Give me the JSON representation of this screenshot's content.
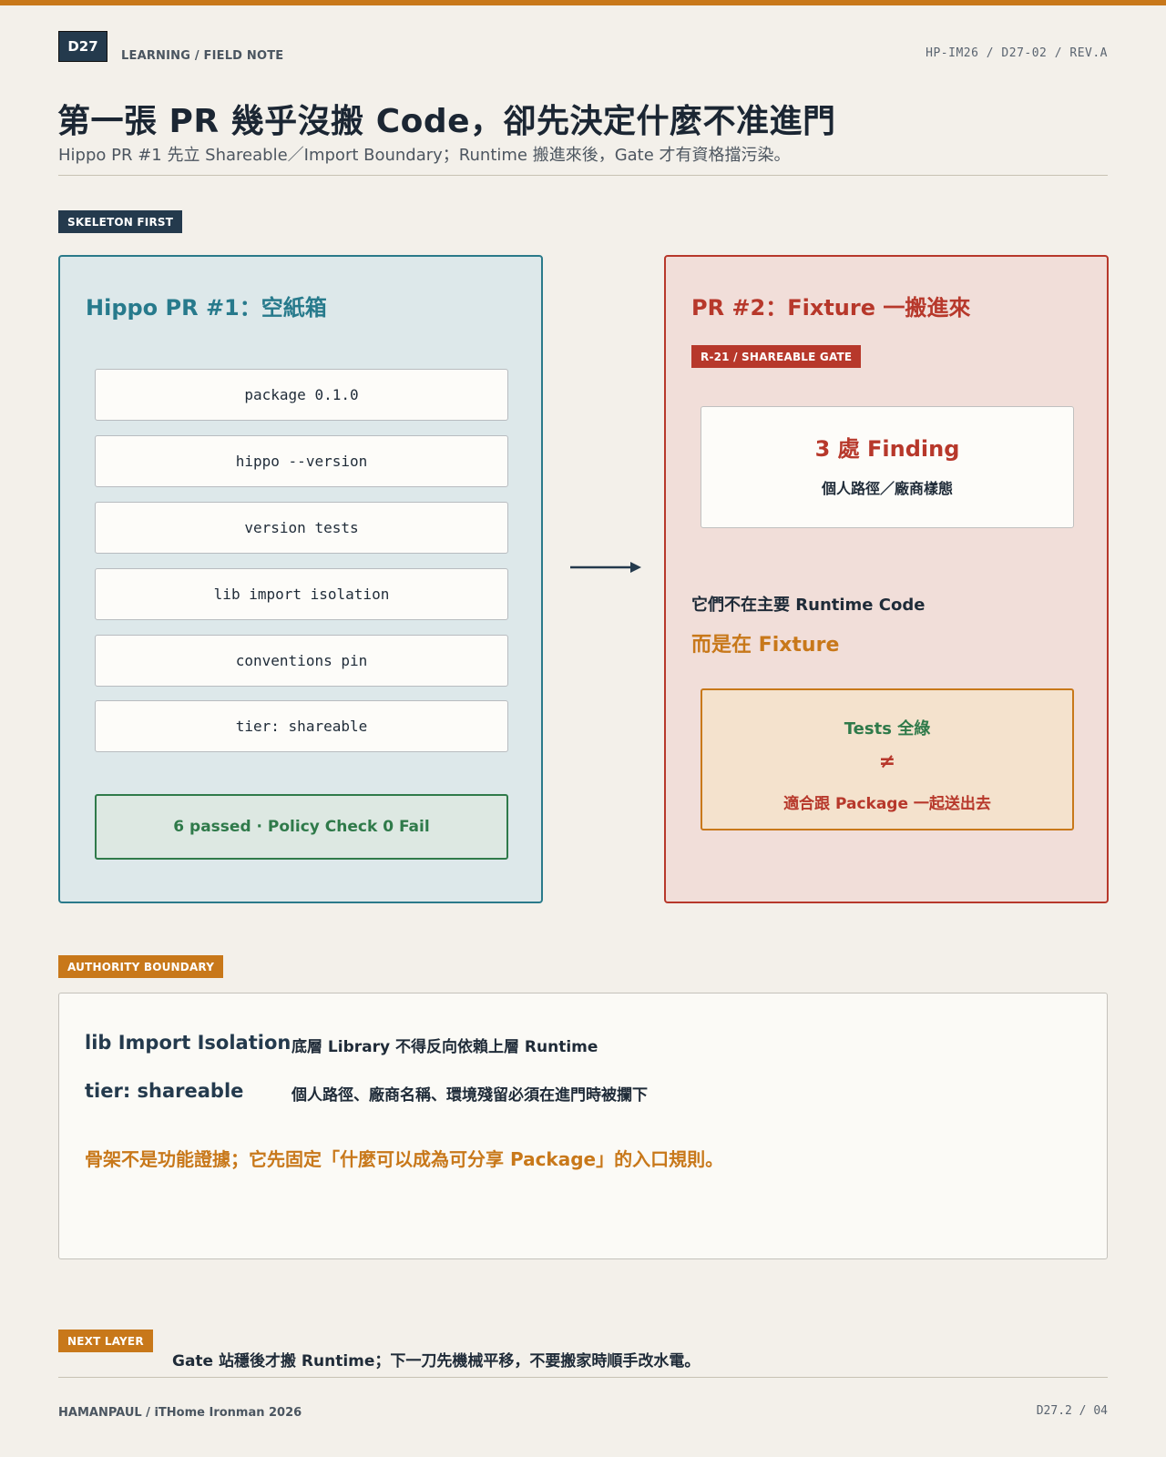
{
  "header": {
    "day_badge": "D27",
    "kicker": "LEARNING / FIELD NOTE",
    "doc_ref": "HP-IM26 / D27-02 / REV.A",
    "title": "第一張 PR 幾乎沒搬 Code，卻先決定什麼不准進門",
    "subtitle": "Hippo PR #1 先立 Shareable／Import Boundary；Runtime 搬進來後，Gate 才有資格擋污染。"
  },
  "skeleton": {
    "tag": "SKELETON FIRST",
    "left_panel": {
      "title": "Hippo PR #1：空紙箱",
      "items": [
        "package 0.1.0",
        "hippo --version",
        "version tests",
        "lib import isolation",
        "conventions pin",
        "tier: shareable"
      ],
      "status": "6 passed · Policy Check 0 Fail"
    },
    "right_panel": {
      "title": "PR #2：Fixture 一搬進來",
      "gate_tag": "R-21 / SHAREABLE GATE",
      "finding_title": "3 處 Finding",
      "finding_detail": "個人路徑／廠商樣態",
      "line1": "它們不在主要 Runtime Code",
      "line2": "而是在 Fixture",
      "tests_green": "Tests 全綠",
      "neq": "≠",
      "tests_note": "適合跟 Package 一起送出去"
    }
  },
  "authority": {
    "tag": "AUTHORITY BOUNDARY",
    "rows": [
      {
        "key": "lib Import Isolation",
        "value": "底層 Library 不得反向依賴上層 Runtime"
      },
      {
        "key": "tier: shareable",
        "value": "個人路徑、廠商名稱、環境殘留必須在進門時被攔下"
      }
    ],
    "note": "骨架不是功能證據；它先固定「什麼可以成為可分享 Package」的入口規則。"
  },
  "next": {
    "tag": "NEXT LAYER",
    "text": "Gate 站穩後才搬 Runtime；下一刀先機械平移，不要搬家時順手改水電。"
  },
  "footer": {
    "left": "HAMANPAUL / iTHome Ironman 2026",
    "right": "D27.2 / 04"
  },
  "colors": {
    "accent_orange": "#c8781a",
    "teal": "#277a8c",
    "red": "#b7382b",
    "green": "#2f7a4a",
    "navy": "#243a4d"
  }
}
